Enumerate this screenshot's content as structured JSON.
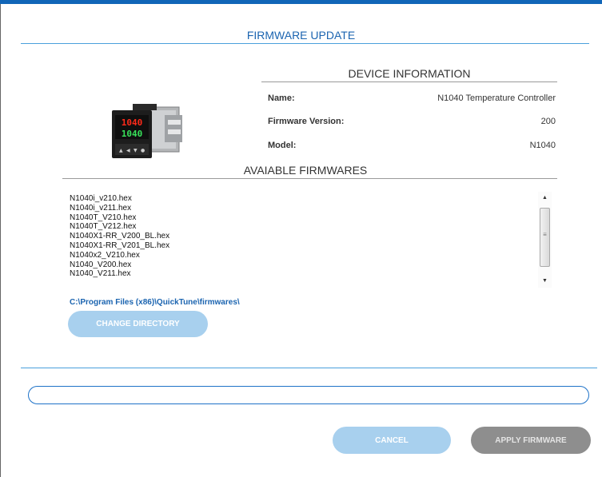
{
  "page": {
    "title": "FIRMWARE UPDATE"
  },
  "device_info": {
    "heading": "DEVICE INFORMATION",
    "rows": [
      {
        "label": "Name:",
        "value": "N1040 Temperature Controller"
      },
      {
        "label": "Firmware Version:",
        "value": "200"
      },
      {
        "label": "Model:",
        "value": "N1040"
      }
    ],
    "image": {
      "icon": "temperature-controller-device",
      "display_top": "1040",
      "display_bottom": "1040"
    }
  },
  "firmwares": {
    "heading": "AVAIABLE FIRMWARES",
    "items": [
      "N1040i_v210.hex",
      "N1040i_v211.hex",
      "N1040T_V210.hex",
      "N1040T_V212.hex",
      "N1040X1-RR_V200_BL.hex",
      "N1040X1-RR_V201_BL.hex",
      "N1040x2_V210.hex",
      "N1040_V200.hex",
      "N1040_V211.hex"
    ],
    "scroll": {
      "up_icon": "▲",
      "down_icon": "▼",
      "grip_icon": "≡"
    }
  },
  "directory": {
    "path": "C:\\Program Files (x86)\\QuickTune\\firmwares\\",
    "change_label": "CHANGE DIRECTORY"
  },
  "actions": {
    "cancel_label": "CANCEL",
    "apply_label": "APPLY FIRMWARE"
  },
  "colors": {
    "accent": "#1166b8",
    "link": "#1b64b0",
    "button_light": "#a8d0ee",
    "button_disabled": "#8e8e8e"
  }
}
